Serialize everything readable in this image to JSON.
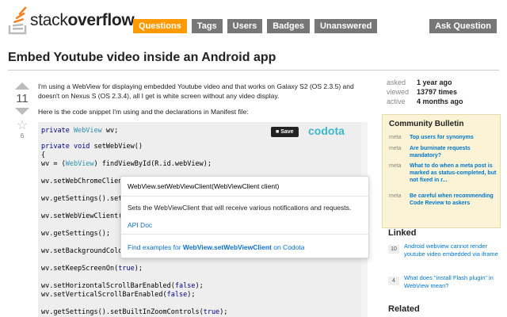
{
  "logo": {
    "text_light": "stack",
    "text_bold": "overflow"
  },
  "nav": [
    {
      "label": "Questions",
      "active": true
    },
    {
      "label": "Tags",
      "active": false
    },
    {
      "label": "Users",
      "active": false
    },
    {
      "label": "Badges",
      "active": false
    },
    {
      "label": "Unanswered",
      "active": false
    }
  ],
  "ask_button": "Ask Question",
  "question": {
    "title": "Embed Youtube video inside an Android app",
    "votes": "11",
    "favorites": "6",
    "paragraphs": [
      "I'm using a WebView for displaying embedded Youtube video and that works on Galaxy S2 (OS 2.3.5) and doesn't on Nexus S (OS 2.3.4), all I get is white screen without any video display.",
      "Here is the code snippet I'm using and the declarations in Manifest file:"
    ]
  },
  "code": {
    "save_label": "Save",
    "codota_label": "codota",
    "lines": [
      "private WebView wv;",
      "private void setWebView()",
      "{",
      "wv = (WebView) findViewById(R.id.webView);",
      "wv.setWebChromeClient(",
      "wv.getSettings().set",
      "wv.setWebViewClient(",
      "wv.getSettings();",
      "wv.setBackgroundColo",
      "wv.setKeepScreenOn(true);",
      "wv.setHorizontalScrollBarEnabled(false);",
      "wv.setVerticalScrollBarEnabled(false);",
      "wv.getSettings().setBuiltInZoomControls(true);"
    ]
  },
  "popup": {
    "signature": "WebView.setWebViewClient(WebViewClient client)",
    "description": "Sets the WebViewClient that will receive various notifications and requests.",
    "api_doc": "API Doc",
    "find_prefix": "Find examples for ",
    "find_method": "WebView.setWebViewClient",
    "find_suffix": " on Codota"
  },
  "stats": [
    {
      "label": "asked",
      "value": "1 year ago"
    },
    {
      "label": "viewed",
      "value": "13797 times"
    },
    {
      "label": "active",
      "value": "4 months ago"
    }
  ],
  "bulletin": {
    "title": "Community Bulletin",
    "items": [
      {
        "tag": "meta",
        "text": "Top users for synonyms"
      },
      {
        "tag": "meta",
        "text": "Are burninate requests mandatory?"
      },
      {
        "tag": "meta",
        "text": "What to do when a meta post is marked as status-completed, but not fixed in r..."
      },
      {
        "tag": "meta",
        "text": "Be careful when recommending Code Review to askers"
      }
    ]
  },
  "linked": {
    "title": "Linked",
    "items": [
      {
        "count": "10",
        "text": "Android webview cannot render youtube video embedded via iframe"
      },
      {
        "count": "4",
        "text": "What does \"install Flash plugin\" in WebView mean?"
      }
    ]
  },
  "related_title": "Related",
  "colors": {
    "accent": "#ff9900",
    "link": "#0077cc",
    "codota": "#3bb8c8",
    "bulletin_bg": "#fbf3d5"
  }
}
